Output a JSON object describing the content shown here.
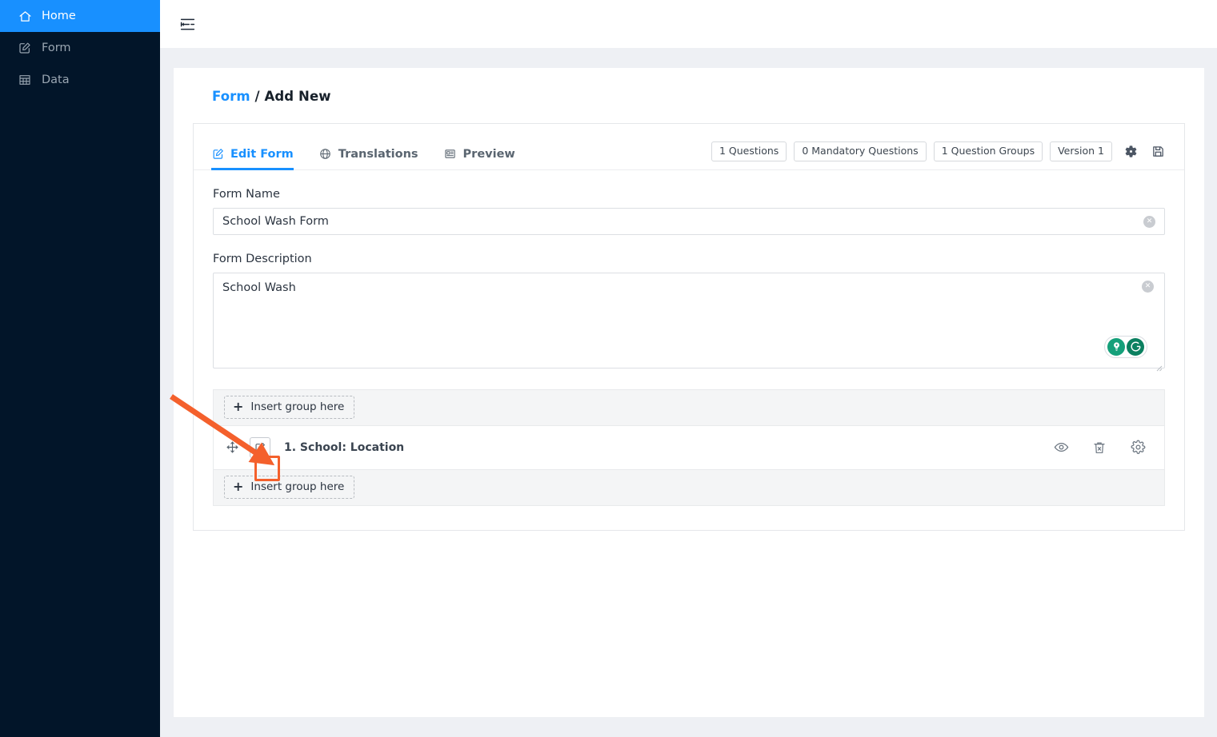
{
  "sidebar": {
    "items": [
      {
        "label": "Home",
        "icon": "home-icon",
        "active": true
      },
      {
        "label": "Form",
        "icon": "form-edit-icon",
        "active": false
      },
      {
        "label": "Data",
        "icon": "table-icon",
        "active": false
      }
    ]
  },
  "topbar": {
    "collapse_icon": "menu-fold-icon"
  },
  "breadcrumb": {
    "link": "Form",
    "separator": "/",
    "current": "Add New"
  },
  "tabs": [
    {
      "label": "Edit Form",
      "icon": "edit-pencil-icon",
      "active": true
    },
    {
      "label": "Translations",
      "icon": "globe-icon",
      "active": false
    },
    {
      "label": "Preview",
      "icon": "layout-preview-icon",
      "active": false
    }
  ],
  "badges": [
    {
      "label": "1 Questions"
    },
    {
      "label": "0 Mandatory Questions"
    },
    {
      "label": "1 Question Groups"
    },
    {
      "label": "Version 1"
    }
  ],
  "toolbar_icons": [
    {
      "name": "settings-gear-icon"
    },
    {
      "name": "save-floppy-icon"
    }
  ],
  "form": {
    "name_label": "Form Name",
    "name_value": "School Wash Form",
    "name_placeholder": "Form Name",
    "description_label": "Form Description",
    "description_value": "School Wash",
    "description_placeholder": "Form Description",
    "clear_icon": "clear-circle-x-icon"
  },
  "grammarly": {
    "bulb_icon": "lightbulb-icon",
    "logo_icon": "grammarly-g-icon"
  },
  "groups": {
    "insert_top_label": "Insert group here",
    "insert_bottom_label": "Insert group here",
    "insert_icon": "plus-icon",
    "question": {
      "title": "1. School: Location",
      "drag_icon": "move-arrows-icon",
      "edit_icon": "edit-pencil-icon",
      "preview_icon": "eye-icon",
      "delete_icon": "trash-x-icon",
      "settings_icon": "gear-icon"
    }
  },
  "annotation": {
    "arrow_color": "#f4602c",
    "highlight_color": "#f4602c"
  },
  "colors": {
    "accent": "#1890ff",
    "sidebar_bg": "#021529",
    "page_bg": "#eef0f4"
  }
}
